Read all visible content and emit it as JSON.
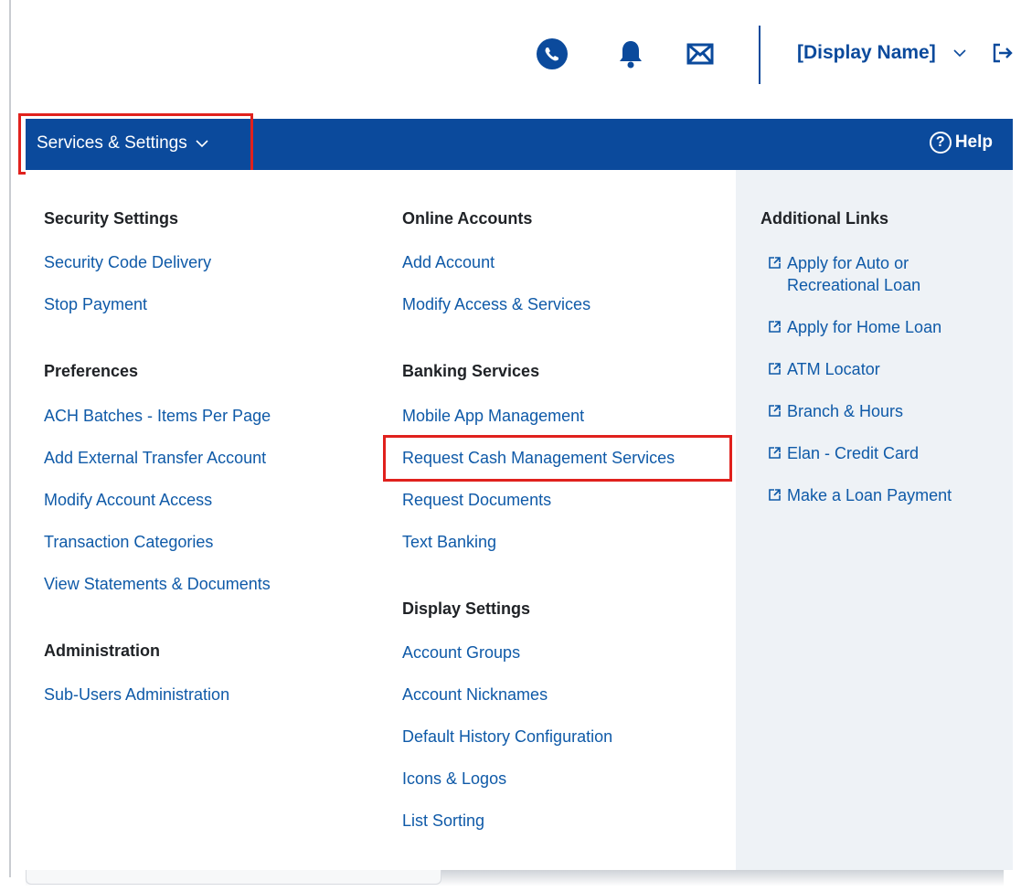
{
  "header": {
    "display_name": "[Display Name]",
    "icons": [
      "phone-icon",
      "bell-icon",
      "mail-icon",
      "chevron-down-icon",
      "logout-icon"
    ]
  },
  "nav": {
    "menu_label": "Services & Settings",
    "help_label": "Help",
    "help_glyph": "?"
  },
  "columns": {
    "col1": {
      "security_title": "Security Settings",
      "security_items": [
        "Security Code Delivery",
        "Stop Payment"
      ],
      "preferences_title": "Preferences",
      "preferences_items": [
        "ACH Batches - Items Per Page",
        "Add External Transfer Account",
        "Modify Account Access",
        "Transaction Categories",
        "View Statements & Documents"
      ],
      "administration_title": "Administration",
      "administration_items": [
        "Sub-Users Administration"
      ]
    },
    "col2": {
      "online_title": "Online Accounts",
      "online_items": [
        "Add Account",
        "Modify Access & Services"
      ],
      "banking_title": "Banking Services",
      "banking_items": [
        "Mobile App Management",
        "Request Cash Management Services",
        "Request Documents",
        "Text Banking"
      ],
      "display_title": "Display Settings",
      "display_items": [
        "Account Groups",
        "Account Nicknames",
        "Default History Configuration",
        "Icons & Logos",
        "List Sorting"
      ]
    },
    "col3": {
      "additional_title": "Additional Links",
      "additional_items": [
        "Apply for Auto or Recreational Loan",
        "Apply for Home Loan",
        "ATM Locator",
        "Branch & Hours",
        "Elan - Credit Card",
        "Make a Loan Payment"
      ]
    }
  },
  "colors": {
    "nav_blue": "#0b4a9c",
    "link_blue": "#0f5aa8",
    "highlight_red": "#e0211d",
    "side_panel": "#eef2f6"
  }
}
